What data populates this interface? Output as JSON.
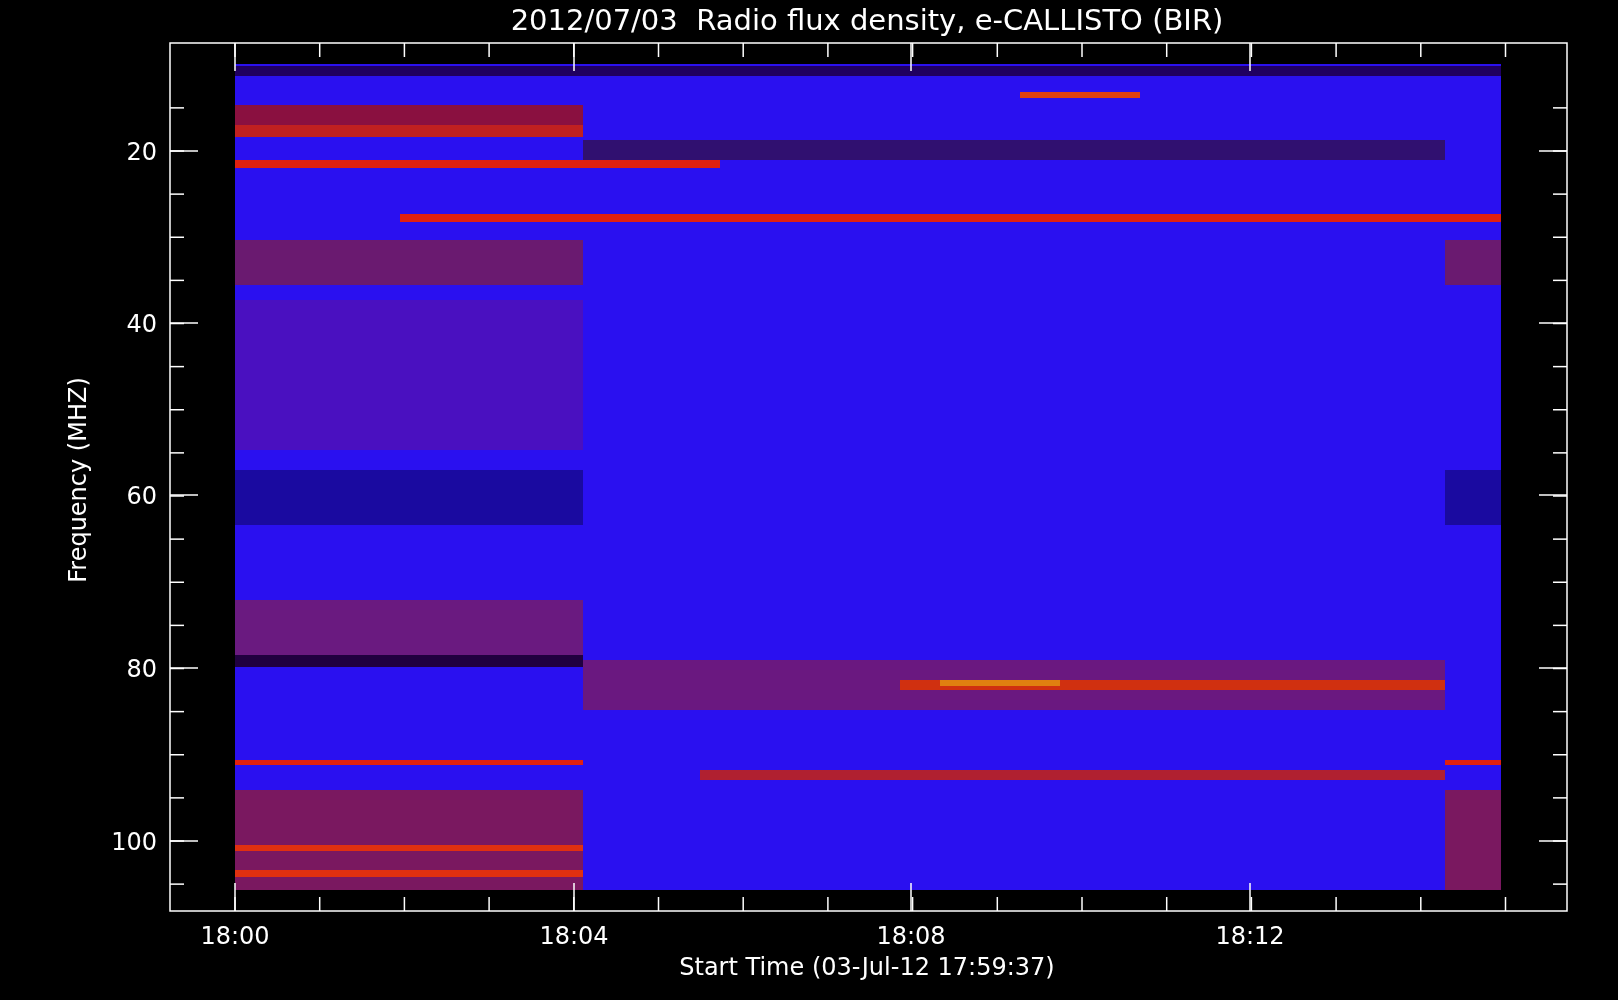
{
  "title": "2012/07/03  Radio flux density, e-CALLISTO (BIR)",
  "y_axis": {
    "label": "Frequency (MHZ)",
    "ticks": [
      "20",
      "40",
      "60",
      "80",
      "100"
    ]
  },
  "x_axis": {
    "label": "Start Time (03-Jul-12 17:59:37)",
    "ticks": [
      "18:00",
      "18:04",
      "18:08",
      "18:12"
    ]
  }
}
